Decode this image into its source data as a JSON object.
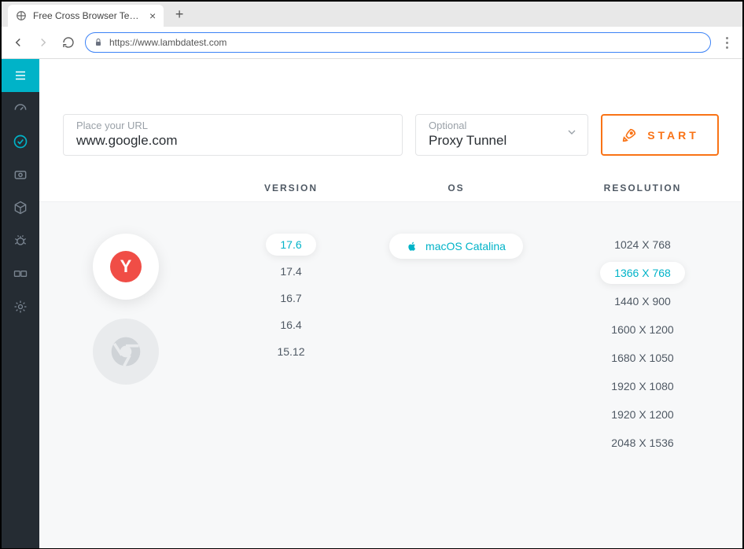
{
  "browser": {
    "tab_title": "Free Cross Browser Testing Clou",
    "url": "https://www.lambdatest.com"
  },
  "inputs": {
    "url_label": "Place your URL",
    "url_value": "www.google.com",
    "proxy_label": "Optional",
    "proxy_value": "Proxy Tunnel",
    "start_label": "START"
  },
  "headers": {
    "version": "VERSION",
    "os": "OS",
    "resolution": "RESOLUTION"
  },
  "browsers": [
    {
      "id": "yandex",
      "label": "Y",
      "active": true
    },
    {
      "id": "chrome",
      "label": "",
      "active": false
    }
  ],
  "versions": [
    {
      "label": "17.6",
      "active": true
    },
    {
      "label": "17.4",
      "active": false
    },
    {
      "label": "16.7",
      "active": false
    },
    {
      "label": "16.4",
      "active": false
    },
    {
      "label": "15.12",
      "active": false
    }
  ],
  "os": {
    "label": "macOS Catalina"
  },
  "resolutions": [
    {
      "label": "1024 X 768",
      "active": false
    },
    {
      "label": "1366 X 768",
      "active": true
    },
    {
      "label": "1440 X 900",
      "active": false
    },
    {
      "label": "1600 X 1200",
      "active": false
    },
    {
      "label": "1680 X 1050",
      "active": false
    },
    {
      "label": "1920 X 1080",
      "active": false
    },
    {
      "label": "1920 X 1200",
      "active": false
    },
    {
      "label": "2048 X 1536",
      "active": false
    }
  ]
}
